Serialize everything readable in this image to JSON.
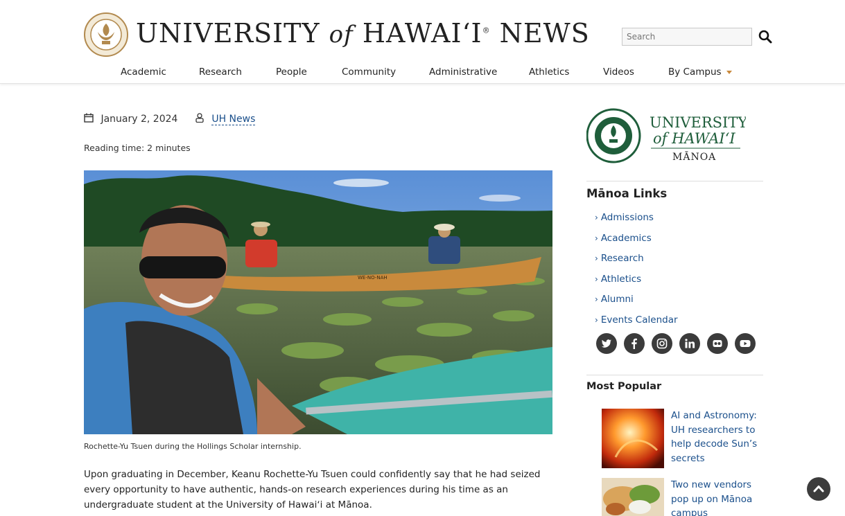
{
  "header": {
    "logo_main": "UNIVERSITY",
    "logo_of": "of",
    "logo_hawaii": "HAWAIʻI",
    "logo_reg": "®",
    "logo_news": "NEWS",
    "search_placeholder": "Search",
    "nav": [
      "Academic",
      "Research",
      "People",
      "Community",
      "Administrative",
      "Athletics",
      "Videos",
      "By Campus"
    ]
  },
  "article": {
    "date": "January 2, 2024",
    "author": "UH News",
    "reading_time": "Reading time: 2 minutes",
    "caption": "Rochette-Yu Tsuen during the Hollings Scholar internship.",
    "body": "Upon graduating in December, Keanu Rochette-Yu Tsuen could confidently say that he had seized every opportunity to have authentic, hands-on research experiences during his time as an undergraduate student at the University of Hawaiʻi at Mānoa.",
    "canoe_text": "WE-NO-NAH"
  },
  "sidebar": {
    "logo_line1": "UNIVERSITY",
    "logo_line2": "of HAWAIʻI",
    "logo_line3": "MĀNOA",
    "links_title": "Mānoa Links",
    "links": [
      "Admissions",
      "Academics",
      "Research",
      "Athletics",
      "Alumni",
      "Events Calendar"
    ],
    "social_icons": [
      "twitter-icon",
      "facebook-icon",
      "instagram-icon",
      "linkedin-icon",
      "flickr-icon",
      "youtube-icon"
    ],
    "popular_title": "Most Popular",
    "popular": [
      "AI and Astronomy: UH researchers to help decode Sun’s secrets",
      "Two new vendors pop up on Mānoa campus"
    ]
  },
  "colors": {
    "link": "#1a4f8b",
    "accent": "#c9893c",
    "manoa_green": "#1f5e3b"
  }
}
